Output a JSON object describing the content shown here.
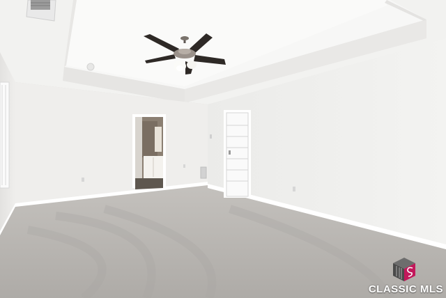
{
  "photo": {
    "subject": "empty-bedroom-interior",
    "colors": {
      "ceiling": "#f1f1ef",
      "wall_left": "#ecebea",
      "wall_back": "#f0efed",
      "wall_right": "#eeeeec",
      "carpet": "#b7b4b0",
      "trim": "#ffffff",
      "fan_blade": "#2e2926"
    }
  },
  "watermark": {
    "brand_text": "CLASSIC MLS",
    "logo_icon": "classic-mls-cube-logo",
    "logo_colors": [
      "#5a5a5a",
      "#c2185b"
    ]
  }
}
